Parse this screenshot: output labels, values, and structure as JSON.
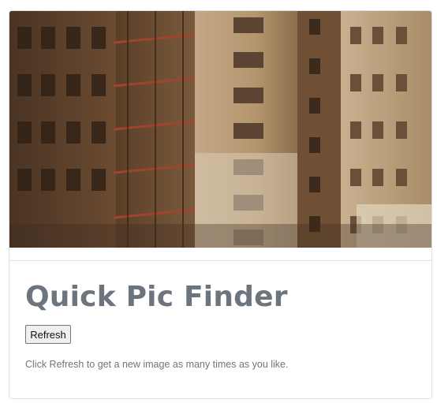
{
  "card": {
    "title": "Quick Pic Finder",
    "refresh_label": "Refresh",
    "hint": "Click Refresh to get a new image as many times as you like."
  },
  "photo": {
    "subject": "city-buildings-photo"
  },
  "colors": {
    "title": "#6c757d",
    "hint": "#6c757d",
    "border": "#dee2e6"
  }
}
